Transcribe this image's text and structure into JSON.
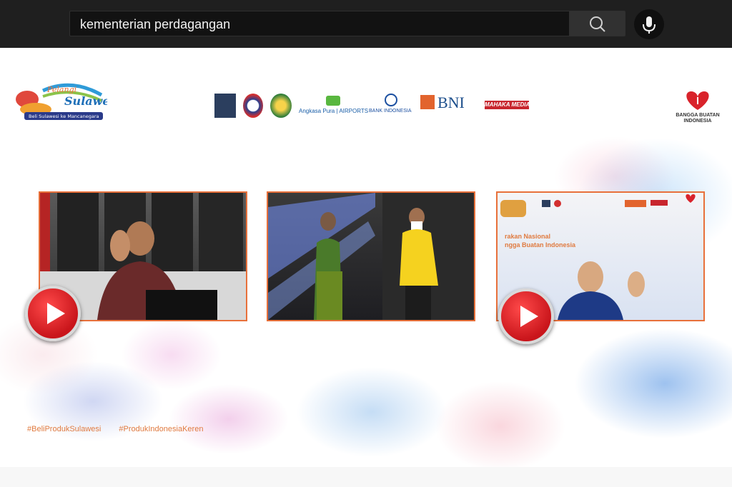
{
  "search": {
    "query": "kementerian perdagangan"
  },
  "icons": {
    "search": "search-icon",
    "mic": "microphone-icon",
    "play": "play-icon"
  },
  "event": {
    "logo_title": "Pelangi Sulawesi",
    "logo_tagline": "Beli Sulawesi ke Mancanegara",
    "right_logo": "BANGGA BUATAN INDONESIA",
    "hashtags": [
      "#BeliProdukSulawesi",
      "#ProdukIndonesiaKeren"
    ]
  },
  "sponsors": [
    "Angkasa Pura | AIRPORTS",
    "BANK INDONESIA",
    "BNI",
    "MAHAKA MEDIA"
  ],
  "videos": [
    {
      "id": "v1"
    },
    {
      "id": "v2"
    },
    {
      "id": "v3",
      "overlay_line1": "rakan Nasional",
      "overlay_line2": "ngga Buatan Indonesia"
    }
  ],
  "colors": {
    "accent_orange": "#e8703a",
    "play_red": "#d7191f",
    "topbar": "#1f1f1f"
  }
}
